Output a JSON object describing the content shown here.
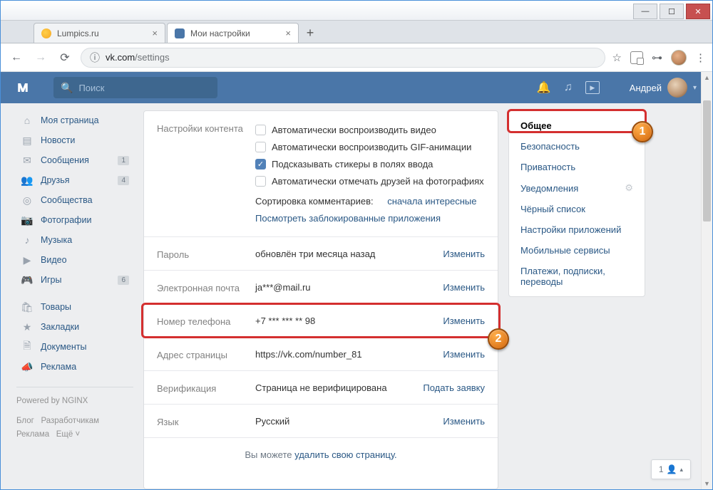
{
  "window": {
    "tabs": [
      {
        "title": "Lumpics.ru"
      },
      {
        "title": "Мои настройки"
      }
    ]
  },
  "url": {
    "domain": "vk.com",
    "path": "/settings"
  },
  "vk_header": {
    "search_placeholder": "Поиск",
    "user_name": "Андрей"
  },
  "left_nav": {
    "items": [
      {
        "icon": "home",
        "label": "Моя страница",
        "badge": ""
      },
      {
        "icon": "news",
        "label": "Новости",
        "badge": ""
      },
      {
        "icon": "msg",
        "label": "Сообщения",
        "badge": "1"
      },
      {
        "icon": "friends",
        "label": "Друзья",
        "badge": "4"
      },
      {
        "icon": "groups",
        "label": "Сообщества",
        "badge": ""
      },
      {
        "icon": "photo",
        "label": "Фотографии",
        "badge": ""
      },
      {
        "icon": "music",
        "label": "Музыка",
        "badge": ""
      },
      {
        "icon": "video",
        "label": "Видео",
        "badge": ""
      },
      {
        "icon": "games",
        "label": "Игры",
        "badge": "6"
      }
    ],
    "items2": [
      {
        "icon": "market",
        "label": "Товары"
      },
      {
        "icon": "fav",
        "label": "Закладки"
      },
      {
        "icon": "docs",
        "label": "Документы"
      },
      {
        "icon": "ads",
        "label": "Реклама"
      }
    ],
    "footer": {
      "powered": "Powered by NGINX",
      "links": [
        "Блог",
        "Разработчикам",
        "Реклама",
        "Ещё ˅"
      ]
    }
  },
  "settings": {
    "content_label": "Настройки контента",
    "chk": [
      {
        "label": "Автоматически воспроизводить видео",
        "checked": false
      },
      {
        "label": "Автоматически воспроизводить GIF-анимации",
        "checked": false
      },
      {
        "label": "Подсказывать стикеры в полях ввода",
        "checked": true
      },
      {
        "label": "Автоматически отмечать друзей на фотографиях",
        "checked": false
      }
    ],
    "sort_label": "Сортировка комментариев:",
    "sort_value": "сначала интересные",
    "blocked_apps": "Посмотреть заблокированные приложения",
    "rows": [
      {
        "label": "Пароль",
        "value": "обновлён три месяца назад",
        "action": "Изменить"
      },
      {
        "label": "Электронная почта",
        "value": "ja***@mail.ru",
        "action": "Изменить"
      },
      {
        "label": "Номер телефона",
        "value": "+7 *** *** ** 98",
        "action": "Изменить"
      },
      {
        "label": "Адрес страницы",
        "value": "https://vk.com/number_81",
        "action": "Изменить"
      },
      {
        "label": "Верификация",
        "value": "Страница не верифицирована",
        "action": "Подать заявку"
      },
      {
        "label": "Язык",
        "value": "Русский",
        "action": "Изменить"
      }
    ],
    "delete_prefix": "Вы можете ",
    "delete_link": "удалить свою страницу."
  },
  "right_nav": {
    "items": [
      "Общее",
      "Безопасность",
      "Приватность",
      "Уведомления",
      "Чёрный список",
      "Настройки приложений",
      "Мобильные сервисы",
      "Платежи, подписки, переводы"
    ]
  },
  "friend_widget": {
    "count": "1"
  },
  "callouts": {
    "b1": "1",
    "b2": "2"
  }
}
